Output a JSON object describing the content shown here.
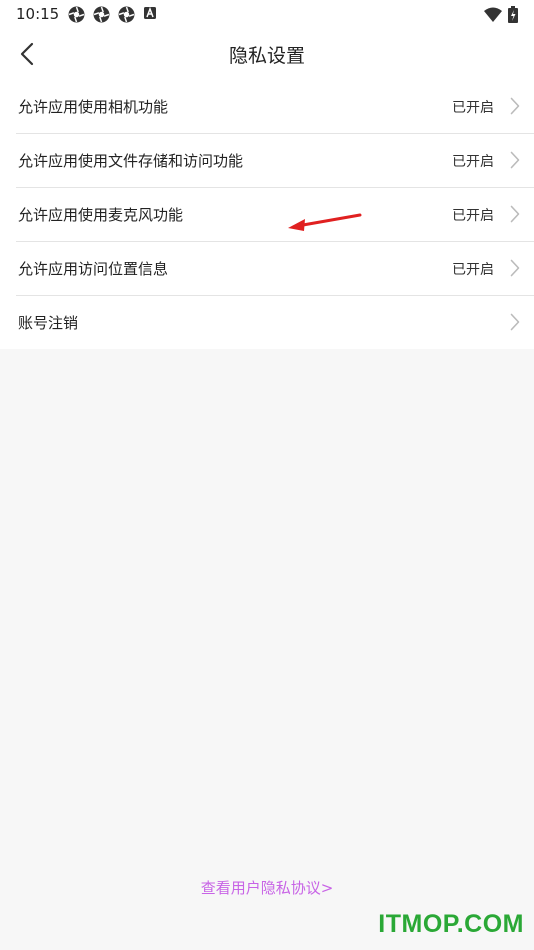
{
  "status_bar": {
    "time": "10:15",
    "left_icons": [
      "aperture-icon",
      "aperture-icon",
      "aperture-icon",
      "notification-a-icon"
    ],
    "right_icons": [
      "wifi-icon",
      "battery-charging-icon"
    ]
  },
  "header": {
    "back_icon": "chevron-left-icon",
    "title": "隐私设置"
  },
  "settings": {
    "items": [
      {
        "label": "允许应用使用相机功能",
        "status": "已开启"
      },
      {
        "label": "允许应用使用文件存储和访问功能",
        "status": "已开启"
      },
      {
        "label": "允许应用使用麦克风功能",
        "status": "已开启"
      },
      {
        "label": "允许应用访问位置信息",
        "status": "已开启"
      },
      {
        "label": "账号注销",
        "status": ""
      }
    ]
  },
  "footer": {
    "policy_link": "查看用户隐私协议>"
  },
  "watermark": "ITMOP.COM",
  "colors": {
    "background": "#f7f7f7",
    "link": "#c864e6",
    "watermark": "#2aa836",
    "annotation": "#e02020"
  }
}
